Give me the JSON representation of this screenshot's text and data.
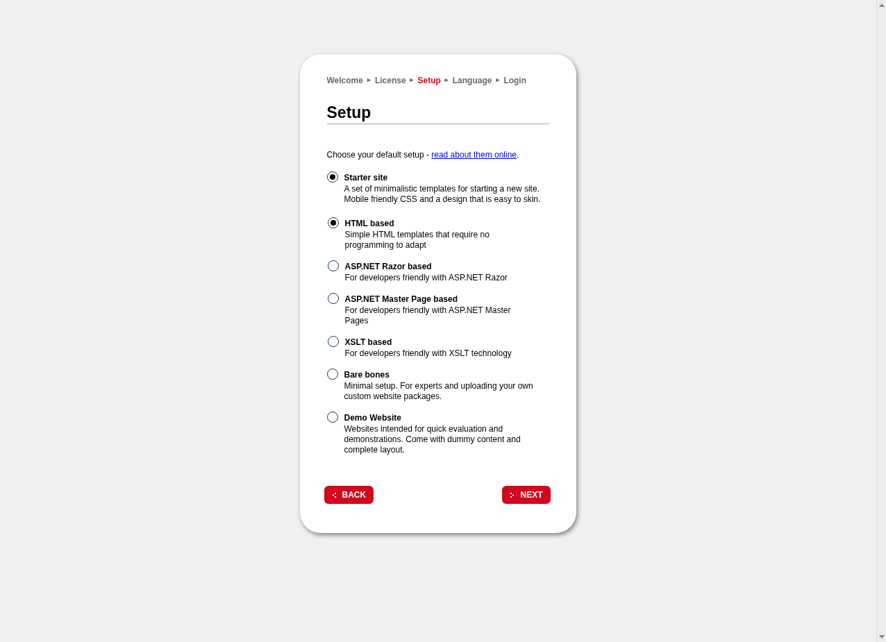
{
  "breadcrumb": [
    {
      "label": "Welcome",
      "selected": false
    },
    {
      "label": "License",
      "selected": false
    },
    {
      "label": "Setup",
      "selected": true
    },
    {
      "label": "Language",
      "selected": false
    },
    {
      "label": "Login",
      "selected": false
    }
  ],
  "breadcrumb_separator": "►",
  "title": "Setup",
  "intro": {
    "text": "Choose your default setup - ",
    "link": "read about them online",
    "suffix": "."
  },
  "options": [
    {
      "label": "Starter site",
      "description": "A set of minimalistic templates for starting a new site. Mobile friendly CSS and a design that is easy to skin.",
      "selected": true,
      "children": [
        {
          "label": "HTML based",
          "description": "Simple HTML templates that require no programming to adapt",
          "selected": true
        },
        {
          "label": "ASP.NET Razor based",
          "description": "For developers friendly with ASP.NET Razor",
          "selected": false
        },
        {
          "label": "ASP.NET Master Page based",
          "description": "For developers friendly with ASP.NET Master Pages",
          "selected": false
        },
        {
          "label": "XSLT based",
          "description": "For developers friendly with XSLT technology",
          "selected": false
        }
      ]
    },
    {
      "label": "Bare bones",
      "description": "Minimal setup. For experts and uploading your own custom website packages.",
      "selected": false
    },
    {
      "label": "Demo Website",
      "description": "Websites intended for quick evaluation and demonstrations. Come with dummy content and complete layout.",
      "selected": false
    }
  ],
  "buttons": [
    {
      "label": "BACK",
      "kind": "back"
    },
    {
      "label": "NEXT",
      "kind": "next"
    }
  ]
}
